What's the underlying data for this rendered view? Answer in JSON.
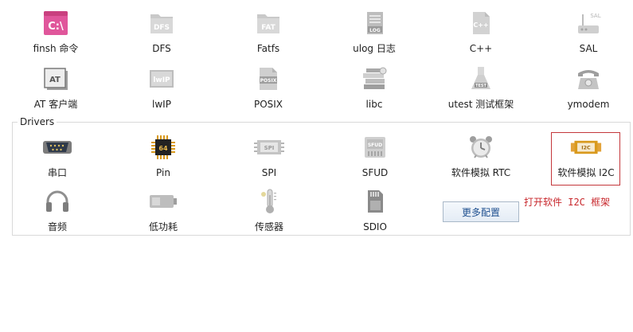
{
  "components": {
    "items": [
      {
        "label": "finsh 命令",
        "icon": "terminal-icon"
      },
      {
        "label": "DFS",
        "icon": "folder-dfs-icon"
      },
      {
        "label": "Fatfs",
        "icon": "folder-fat-icon"
      },
      {
        "label": "ulog 日志",
        "icon": "log-document-icon"
      },
      {
        "label": "C++",
        "icon": "cpp-file-icon"
      },
      {
        "label": "SAL",
        "icon": "router-icon"
      },
      {
        "label": "AT 客户端",
        "icon": "at-client-icon"
      },
      {
        "label": "lwIP",
        "icon": "lwip-icon"
      },
      {
        "label": "POSIX",
        "icon": "posix-document-icon"
      },
      {
        "label": "libc",
        "icon": "books-icon"
      },
      {
        "label": "utest 测试框架",
        "icon": "test-flask-icon"
      },
      {
        "label": "ymodem",
        "icon": "telephone-icon"
      }
    ]
  },
  "drivers": {
    "group_title": "Drivers",
    "items": [
      {
        "label": "串口",
        "icon": "serial-port-icon"
      },
      {
        "label": "Pin",
        "icon": "chip-pin-icon"
      },
      {
        "label": "SPI",
        "icon": "spi-chip-icon"
      },
      {
        "label": "SFUD",
        "icon": "sfud-flash-icon"
      },
      {
        "label": "软件模拟 RTC",
        "icon": "alarm-clock-icon"
      },
      {
        "label": "软件模拟 I2C",
        "icon": "i2c-chip-icon"
      },
      {
        "label": "音频",
        "icon": "headphones-icon"
      },
      {
        "label": "低功耗",
        "icon": "battery-icon"
      },
      {
        "label": "传感器",
        "icon": "thermometer-icon"
      },
      {
        "label": "SDIO",
        "icon": "sd-card-icon"
      }
    ],
    "more_button": "更多配置",
    "annotation": "打开软件 I2C 框架"
  },
  "colors": {
    "finsh_pink": "#e0569b",
    "chip_gold": "#d99a1e",
    "annotation_red": "#c8282d",
    "disabled_gray": "#c8c8c8"
  }
}
